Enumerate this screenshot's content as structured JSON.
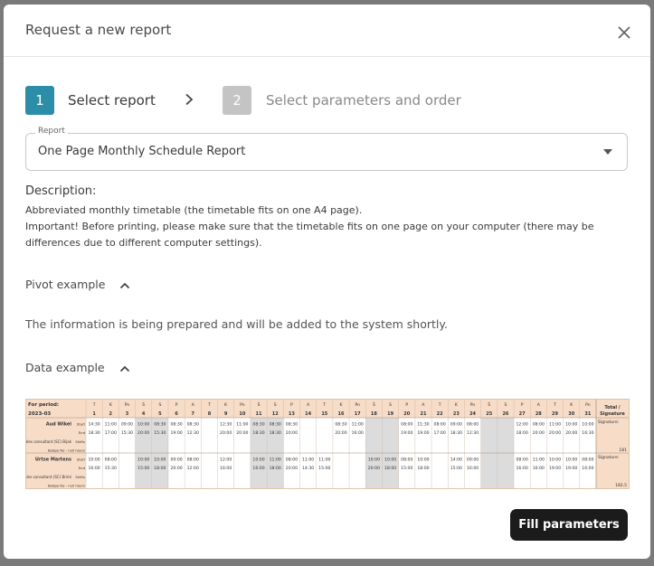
{
  "modal": {
    "title": "Request a new report"
  },
  "stepper": {
    "steps": [
      {
        "number": "1",
        "label": "Select report",
        "active": true
      },
      {
        "number": "2",
        "label": "Select parameters and order",
        "active": false
      }
    ]
  },
  "report_field": {
    "legend": "Report",
    "value": "One Page Monthly Schedule Report"
  },
  "description": {
    "title": "Description:",
    "line1": "Abbreviated monthly timetable (the timetable fits on one A4 page).",
    "line2": "Important! Before printing, please make sure that the timetable fits on one page on your computer (there may be differences due to different computer settings)."
  },
  "pivot": {
    "label": "Pivot example",
    "info": "The information is being prepared and will be added to the system shortly."
  },
  "data_example": {
    "label": "Data example",
    "period_label": "For period:",
    "period_value": "2023-03",
    "total_label": "Total /",
    "signature_label": "Signature",
    "days": [
      "1",
      "2",
      "3",
      "4",
      "5",
      "6",
      "7",
      "8",
      "9",
      "10",
      "11",
      "12",
      "13",
      "14",
      "15",
      "16",
      "17",
      "18",
      "19",
      "20",
      "21",
      "22",
      "23",
      "24",
      "25",
      "26",
      "27",
      "28",
      "29",
      "30",
      "31"
    ],
    "weekday_initials": [
      "T",
      "K",
      "Pn",
      "Š",
      "S",
      "P",
      "A",
      "T",
      "K",
      "Pn",
      "Š",
      "S",
      "P",
      "A",
      "T",
      "K",
      "Pn",
      "Š",
      "S",
      "P",
      "A",
      "T",
      "K",
      "Pn",
      "Š",
      "S",
      "P",
      "A",
      "T",
      "K",
      "Pn"
    ],
    "employees": [
      {
        "name": "Aud Wikel",
        "role": "senior sales consultant (SC) Bijak",
        "row_labels": [
          "Start",
          "End",
          "Shifts",
          "Badge No - null hours"
        ],
        "start": [
          "14:30",
          "11:00",
          "09:00",
          "10:00",
          "08:30",
          "08:30",
          "08:30",
          "",
          "12:30",
          "11:00",
          "08:30",
          "08:30",
          "08:30",
          "",
          "",
          "08:30",
          "11:00",
          "",
          "",
          "08:00",
          "11:30",
          "08:00",
          "09:00",
          "08:00",
          "",
          "",
          "12:00",
          "08:00",
          "11:00",
          "10:00",
          "10:00"
        ],
        "end": [
          "18:30",
          "17:00",
          "15:30",
          "20:00",
          "15:30",
          "19:00",
          "12:30",
          "",
          "20:00",
          "20:00",
          "18:30",
          "18:30",
          "20:00",
          "",
          "",
          "20:00",
          "16:00",
          "",
          "",
          "19:00",
          "19:00",
          "17:00",
          "18:30",
          "12:30",
          "",
          "",
          "18:00",
          "20:00",
          "20:00",
          "20:00",
          "16:30"
        ],
        "total": "181",
        "signature": "Signature:"
      },
      {
        "name": "Urtse Martens",
        "role": "sales consultant (SC) Brimi",
        "row_labels": [
          "Start",
          "End",
          "Shifts",
          "Badge No - null hours"
        ],
        "start": [
          "10:00",
          "08:00",
          "",
          "10:00",
          "10:00",
          "09:00",
          "08:00",
          "",
          "12:00",
          "",
          "10:00",
          "11:00",
          "08:00",
          "11:00",
          "11:00",
          "",
          "",
          "10:00",
          "10:00",
          "08:00",
          "10:00",
          "",
          "14:00",
          "09:00",
          "",
          "",
          "08:00",
          "11:00",
          "10:00",
          "10:00",
          "08:00"
        ],
        "end": [
          "16:00",
          "15:30",
          "",
          "15:00",
          "18:00",
          "20:00",
          "12:00",
          "",
          "16:00",
          "",
          "16:00",
          "18:00",
          "20:00",
          "14:30",
          "15:00",
          "",
          "",
          "20:00",
          "18:00",
          "15:00",
          "18:00",
          "",
          "15:00",
          "16:00",
          "",
          "",
          "16:00",
          "16:00",
          "19:00",
          "19:00",
          "16:00"
        ],
        "total": "182,5",
        "signature": "Signature:"
      }
    ]
  },
  "actions": {
    "fill_label": "Fill parameters"
  },
  "colors": {
    "step_active": "#2c8da8",
    "step_inactive": "#c4c4c4",
    "table_header_bg": "#f7dcc7",
    "weekend_bg": "#dcdcdc"
  }
}
